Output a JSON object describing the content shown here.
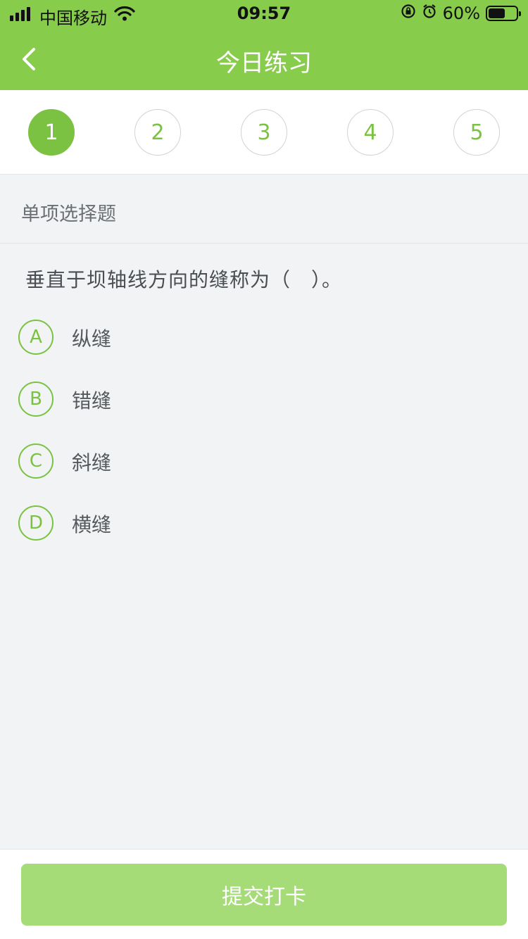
{
  "status_bar": {
    "carrier": "中国移动",
    "time": "09:57",
    "battery_percent": "60%",
    "battery_level": 0.6,
    "icons": [
      "signal-icon",
      "wifi-icon",
      "orientation-lock-icon",
      "alarm-icon",
      "battery-icon"
    ]
  },
  "nav": {
    "title": "今日练习",
    "back_icon": "chevron-left-icon"
  },
  "steps": {
    "items": [
      "1",
      "2",
      "3",
      "4",
      "5"
    ],
    "active_index": 0
  },
  "question_type": "单项选择题",
  "question": "垂直于坝轴线方向的缝称为（　）。",
  "options": [
    {
      "letter": "A",
      "text": "纵缝"
    },
    {
      "letter": "B",
      "text": "错缝"
    },
    {
      "letter": "C",
      "text": "斜缝"
    },
    {
      "letter": "D",
      "text": "横缝"
    }
  ],
  "submit_label": "提交打卡",
  "colors": {
    "brand_green": "#88cc4c",
    "accent_green": "#7cc242",
    "submit_disabled": "#a6dc78"
  }
}
